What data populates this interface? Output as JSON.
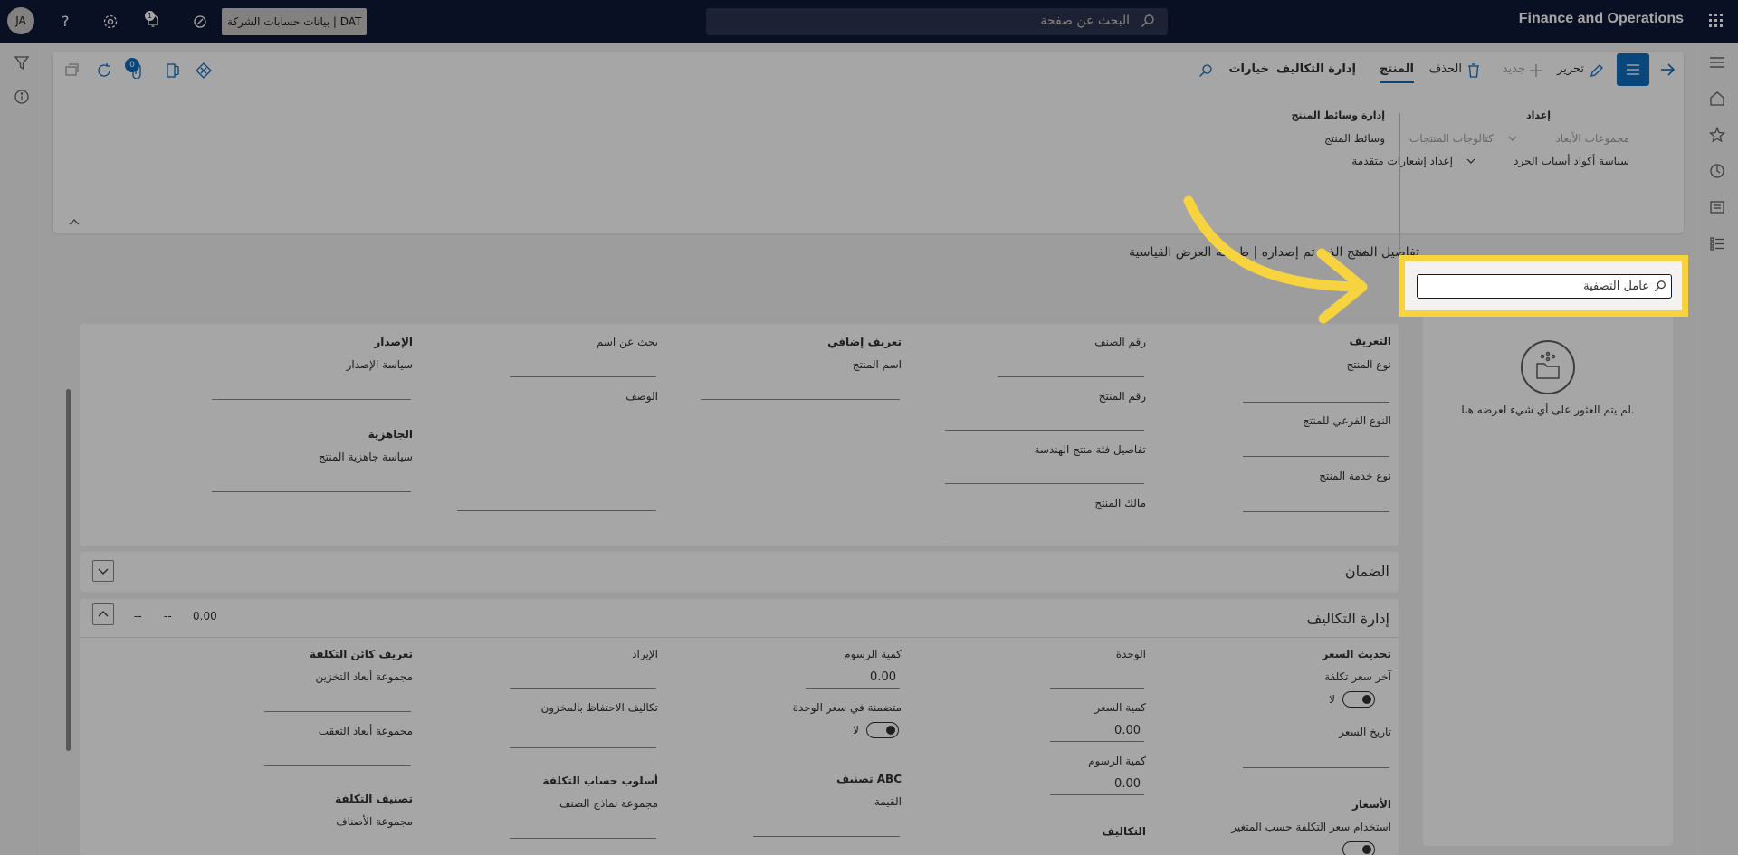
{
  "topbar": {
    "app_name": "Finance and Operations",
    "search_placeholder": "البحث عن صفحة",
    "company": "بيانات حسابات الشركة | DAT",
    "avatar": "JA",
    "notifications": "1"
  },
  "actions": {
    "edit": "تحرير",
    "new": "جديد",
    "delete": "الحذف",
    "tabs": [
      "المنتج",
      "إدارة التكاليف",
      "خيارات"
    ],
    "badge": "0"
  },
  "action_groups": {
    "setup_title": "إعداد",
    "setup_items": [
      "مجموعات الأبعاد",
      "كتالوجات المنتجات",
      "سياسة أكواد أسباب الجرد",
      "إعداد إشعارات متقدمة"
    ],
    "media_title": "إدارة وسائط المنتج",
    "media_items": [
      "وسائط المنتج"
    ]
  },
  "page": {
    "title": "تفاصيل المنتج الذي تم إصداره | طريقة العرض القياسية"
  },
  "filter": {
    "placeholder": "عامل التصفية"
  },
  "factbox": {
    "empty_text": "لم يتم العثور على أي شيء لعرضه هنا."
  },
  "identification": {
    "col1": {
      "title": "التعريف",
      "fields": [
        "نوع المنتج",
        "النوع الفرعي للمنتج",
        "نوع خدمة المنتج"
      ]
    },
    "col2": {
      "fields": [
        "رقم الصنف",
        "رقم المنتج",
        "تفاصيل فئة منتج الهندسة",
        "مالك المنتج"
      ]
    },
    "col3": {
      "title": "تعريف إضافي",
      "fields": [
        "اسم المنتج"
      ]
    },
    "col4": {
      "fields": [
        "بحث عن اسم",
        "الوصف"
      ]
    },
    "col5": {
      "title": "الإصدار",
      "fields": [
        "سياسة الإصدار"
      ],
      "title2": "الجاهزية",
      "fields2": [
        "سياسة جاهزية المنتج"
      ]
    }
  },
  "warranty": {
    "title": "الضمان"
  },
  "costs": {
    "title": "إدارة التكاليف",
    "summary": [
      "0.00",
      "--",
      "--"
    ],
    "col1": {
      "title": "تحديث السعر",
      "fields": [
        "آخر سعر تكلفة",
        "تاريخ السعر"
      ],
      "toggle_value": "لا",
      "title2": "الأسعار",
      "fields2": [
        "استخدام سعر التكلفة حسب المتغير"
      ]
    },
    "col2": {
      "fields": [
        "الوحدة",
        "كمية السعر",
        "كمية الرسوم"
      ],
      "values": [
        "0.00",
        "0.00"
      ],
      "title2": "التكاليف"
    },
    "col3": {
      "fields": [
        "كمية الرسوم",
        "متضمنة في سعر الوحدة"
      ],
      "value": "0.00",
      "toggle_value": "لا",
      "title2": "تصنيف ABC",
      "fields2": [
        "القيمة"
      ]
    },
    "col4": {
      "fields": [
        "الإيراد",
        "تكاليف الاحتفاظ بالمخزون"
      ],
      "title2": "أسلوب حساب التكلفة",
      "fields2": [
        "مجموعة نماذج الصنف"
      ]
    },
    "col5": {
      "title": "تعريف كائن التكلفة",
      "fields": [
        "مجموعة أبعاد التخزين",
        "مجموعة أبعاد التعقب"
      ],
      "title2": "تصنيف التكلفة",
      "fields2": [
        "مجموعة الأصناف"
      ]
    }
  },
  "colors": {
    "topbar": "#0f1a36",
    "accent": "#0f6cbd",
    "highlight": "#f7d43f"
  }
}
